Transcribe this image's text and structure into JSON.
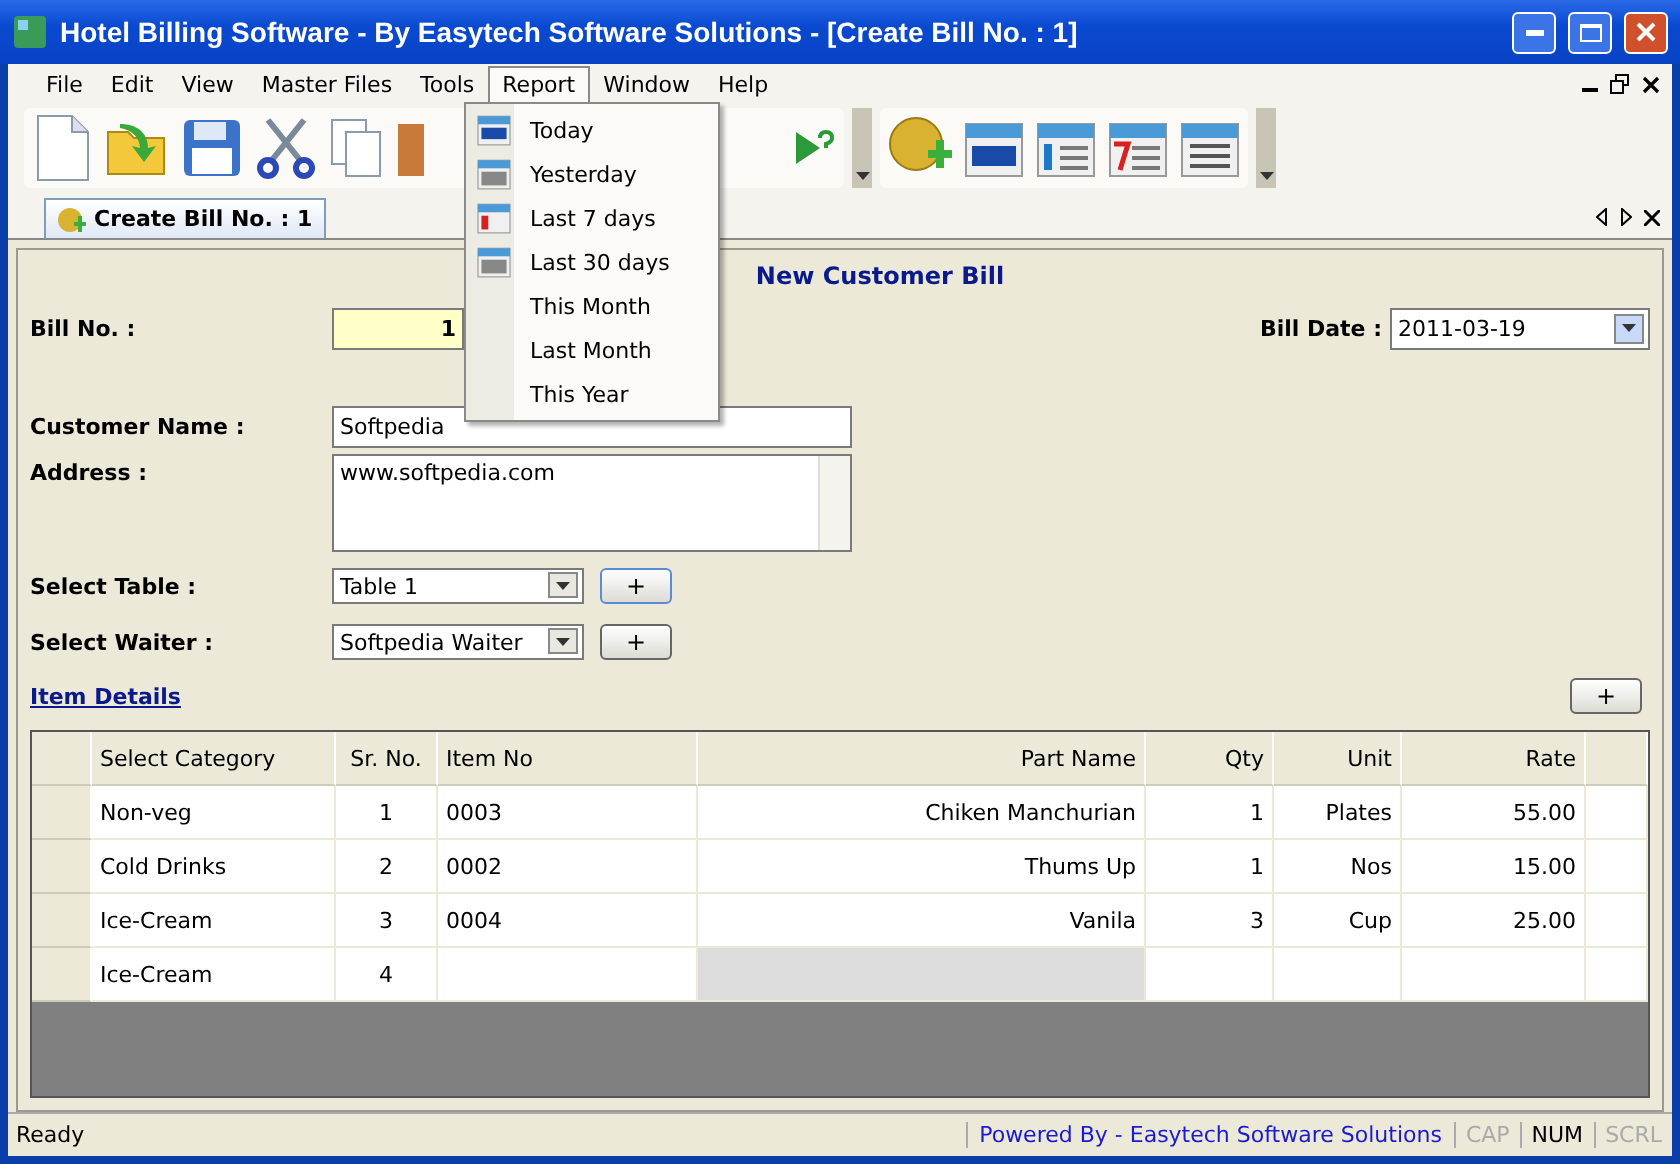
{
  "window": {
    "title": "Hotel Billing Software - By Easytech Software Solutions - [Create Bill No. : 1]"
  },
  "menu": [
    {
      "label": "File",
      "selected": false
    },
    {
      "label": "Edit",
      "selected": false
    },
    {
      "label": "View",
      "selected": false
    },
    {
      "label": "Master Files",
      "selected": false
    },
    {
      "label": "Tools",
      "selected": false
    },
    {
      "label": "Report",
      "selected": true
    },
    {
      "label": "Window",
      "selected": false
    },
    {
      "label": "Help",
      "selected": false
    }
  ],
  "report_menu": [
    {
      "label": "Today",
      "kind": "day"
    },
    {
      "label": "Yesterday",
      "kind": "one"
    },
    {
      "label": "Last 7 days",
      "kind": "seven"
    },
    {
      "label": "Last 30 days",
      "kind": "month"
    },
    {
      "label": "This Month"
    },
    {
      "label": "Last Month"
    },
    {
      "label": "This Year"
    }
  ],
  "doc_tab": {
    "label": "Create Bill No. : 1",
    "selected": true
  },
  "form": {
    "heading": "New Customer Bill",
    "bill_no": {
      "label": "Bill No. :",
      "value": "1"
    },
    "bill_date": {
      "label": "Bill Date :",
      "value": "2011-03-19"
    },
    "customer_name": {
      "label": "Customer Name :",
      "value": "Softpedia"
    },
    "address": {
      "label": "Address :",
      "value": "www.softpedia.com"
    },
    "select_table": {
      "label": "Select Table :",
      "value": "Table 1",
      "add": "+"
    },
    "select_waiter": {
      "label": "Select Waiter :",
      "value": "Softpedia Waiter",
      "add": "+"
    },
    "item_details": {
      "label": "Item Details",
      "add": "+"
    }
  },
  "table": {
    "columns": [
      "Select Category",
      "Sr. No.",
      "Item No",
      "Part Name",
      "Qty",
      "Unit",
      "Rate"
    ],
    "rows": [
      {
        "category": "Non-veg",
        "sr_no": "1",
        "item_no": "0003",
        "part_name": "Chiken Manchurian",
        "qty": "1",
        "unit": "Plates",
        "rate": "55.00",
        "part_name_shaded": false
      },
      {
        "category": "Cold Drinks",
        "sr_no": "2",
        "item_no": "0002",
        "part_name": "Thums Up",
        "qty": "1",
        "unit": "Nos",
        "rate": "15.00",
        "part_name_shaded": false
      },
      {
        "category": "Ice-Cream",
        "sr_no": "3",
        "item_no": "0004",
        "part_name": "Vanila",
        "qty": "3",
        "unit": "Cup",
        "rate": "25.00",
        "part_name_shaded": false
      },
      {
        "category": "Ice-Cream",
        "sr_no": "4",
        "part_name_shaded": true
      }
    ]
  },
  "status_bar": {
    "message": "Ready",
    "powered_by": "Powered By - Easytech Software Solutions",
    "indicators": [
      {
        "label": "CAP",
        "on": false
      },
      {
        "label": "NUM",
        "on": true
      },
      {
        "label": "SCRL",
        "on": false
      }
    ]
  }
}
